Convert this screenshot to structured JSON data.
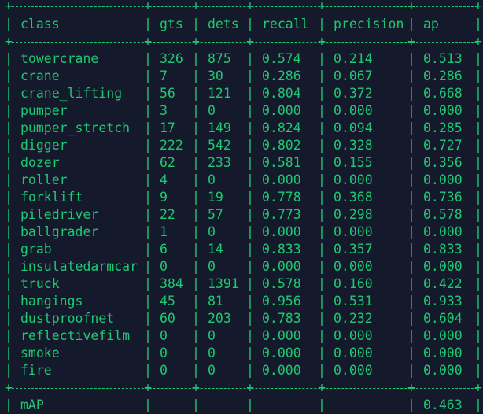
{
  "theme": {
    "background": "#141a2b",
    "text": "#1ec872"
  },
  "table": {
    "headers": [
      "class",
      "gts",
      "dets",
      "recall",
      "precision",
      "ap"
    ],
    "rows": [
      [
        "towercrane",
        "326",
        "875",
        "0.574",
        "0.214",
        "0.513"
      ],
      [
        "crane",
        "7",
        "30",
        "0.286",
        "0.067",
        "0.286"
      ],
      [
        "crane_lifting",
        "56",
        "121",
        "0.804",
        "0.372",
        "0.668"
      ],
      [
        "pumper",
        "3",
        "0",
        "0.000",
        "0.000",
        "0.000"
      ],
      [
        "pumper_stretch",
        "17",
        "149",
        "0.824",
        "0.094",
        "0.285"
      ],
      [
        "digger",
        "222",
        "542",
        "0.802",
        "0.328",
        "0.727"
      ],
      [
        "dozer",
        "62",
        "233",
        "0.581",
        "0.155",
        "0.356"
      ],
      [
        "roller",
        "4",
        "0",
        "0.000",
        "0.000",
        "0.000"
      ],
      [
        "forklift",
        "9",
        "19",
        "0.778",
        "0.368",
        "0.736"
      ],
      [
        "piledriver",
        "22",
        "57",
        "0.773",
        "0.298",
        "0.578"
      ],
      [
        "ballgrader",
        "1",
        "0",
        "0.000",
        "0.000",
        "0.000"
      ],
      [
        "grab",
        "6",
        "14",
        "0.833",
        "0.357",
        "0.833"
      ],
      [
        "insulatedarmcar",
        "0",
        "0",
        "0.000",
        "0.000",
        "0.000"
      ],
      [
        "truck",
        "384",
        "1391",
        "0.578",
        "0.160",
        "0.422"
      ],
      [
        "hangings",
        "45",
        "81",
        "0.956",
        "0.531",
        "0.933"
      ],
      [
        "dustproofnet",
        "60",
        "203",
        "0.783",
        "0.232",
        "0.604"
      ],
      [
        "reflectivefilm",
        "0",
        "0",
        "0.000",
        "0.000",
        "0.000"
      ],
      [
        "smoke",
        "0",
        "0",
        "0.000",
        "0.000",
        "0.000"
      ],
      [
        "fire",
        "0",
        "0",
        "0.000",
        "0.000",
        "0.000"
      ]
    ],
    "summary": [
      "mAP",
      "",
      "",
      "",
      "",
      "0.463"
    ]
  }
}
